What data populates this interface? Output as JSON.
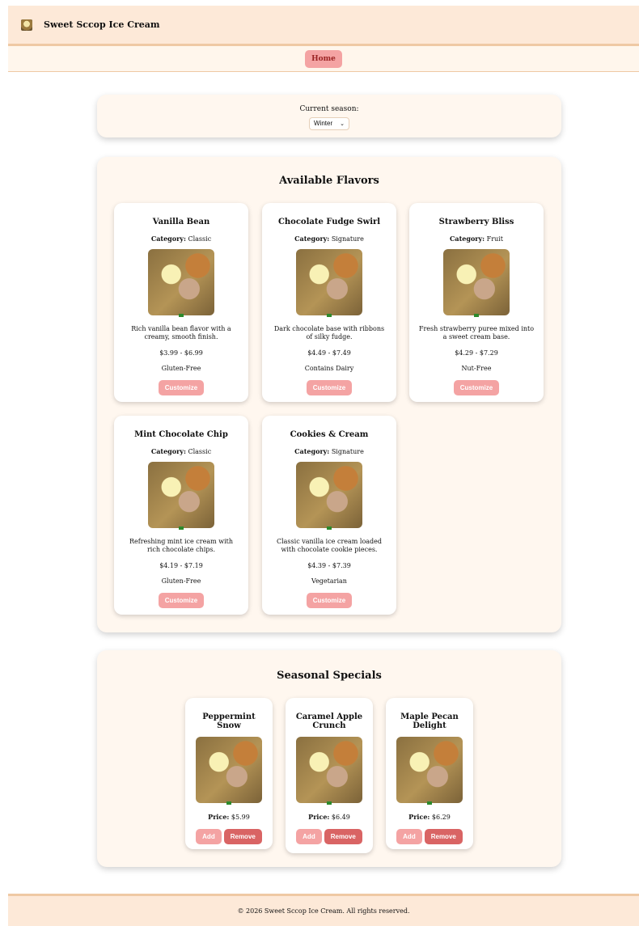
{
  "header": {
    "title": "Sweet Sccop Ice Cream",
    "logo_icon": "ice-cream-sundae-icon"
  },
  "nav": {
    "home_label": "Home"
  },
  "season": {
    "label": "Current season:",
    "selected": "Winter"
  },
  "flavors": {
    "title": "Available Flavors",
    "category_label": "Category:",
    "customize_label": "Customize",
    "items": [
      {
        "name": "Vanilla Bean",
        "category": "Classic",
        "description": "Rich vanilla bean flavor with a creamy, smooth finish.",
        "price": "$3.99 - $6.99",
        "diet": "Gluten-Free"
      },
      {
        "name": "Chocolate Fudge Swirl",
        "category": "Signature",
        "description": "Dark chocolate base with ribbons of silky fudge.",
        "price": "$4.49 - $7.49",
        "diet": "Contains Dairy"
      },
      {
        "name": "Strawberry Bliss",
        "category": "Fruit",
        "description": "Fresh strawberry puree mixed into a sweet cream base.",
        "price": "$4.29 - $7.29",
        "diet": "Nut-Free"
      },
      {
        "name": "Mint Chocolate Chip",
        "category": "Classic",
        "description": "Refreshing mint ice cream with rich chocolate chips.",
        "price": "$4.19 - $7.19",
        "diet": "Gluten-Free"
      },
      {
        "name": "Cookies & Cream",
        "category": "Signature",
        "description": "Classic vanilla ice cream loaded with chocolate cookie pieces.",
        "price": "$4.39 - $7.39",
        "diet": "Vegetarian"
      }
    ]
  },
  "specials": {
    "title": "Seasonal Specials",
    "price_label": "Price:",
    "add_label": "Add",
    "remove_label": "Remove",
    "items": [
      {
        "name": "Peppermint Snow",
        "price": "$5.99"
      },
      {
        "name": "Caramel Apple Crunch",
        "price": "$6.49"
      },
      {
        "name": "Maple Pecan Delight",
        "price": "$6.29"
      }
    ]
  },
  "footer": {
    "text": "© 2026 Sweet Sccop Ice Cream. All rights reserved."
  },
  "colors": {
    "header_bg": "#fde9d8",
    "accent_pink": "#f4a3a3",
    "remove_red": "#d96464",
    "panel_bg": "#fff7ef"
  }
}
